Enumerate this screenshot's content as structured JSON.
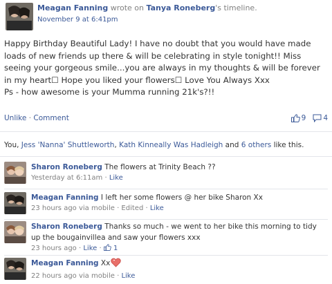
{
  "post": {
    "author": "Meagan Fanning",
    "wrote_on": "wrote on",
    "target": "Tanya Roneberg",
    "target_suffix": "'s timeline.",
    "timestamp": "November 9 at 6:41pm",
    "message": "Happy Birthday Beautiful Lady! I have no doubt that you would have made loads of new friends up there & will be celebrating in style tonight!! Miss seeing your gorgeous smile...you are always in my thoughts & will be forever in my heart☐ Hope you liked your flowers☐ Love You Always Xxx\nPs - how awesome is your Mumma running 21k's?!!"
  },
  "actions": {
    "unlike": "Unlike",
    "separator": "·",
    "comment": "Comment",
    "like_count": "9",
    "comment_count": "4",
    "icons": [
      "thumbs-up-icon",
      "comment-icon"
    ]
  },
  "likes_summary": {
    "prefix": "You, ",
    "name1": "Jess 'Nanna' Shuttleworth",
    "comma": ", ",
    "name2": "Kath Kinneally Was Hadleigh",
    "and": " and ",
    "others": "6 others",
    "suffix": " like this."
  },
  "comments": [
    {
      "author": "Sharon Roneberg",
      "text": "The flowers at Trinity Beach ??",
      "time": "Yesterday at 6:11am",
      "sep": " · ",
      "like": "Like"
    },
    {
      "author": "Meagan Fanning",
      "text": "I left her some flowers @ her bike Sharon Xx",
      "time": "23 hours ago via mobile",
      "edited": " · Edited · ",
      "like": "Like"
    },
    {
      "author": "Sharon Roneberg",
      "text": "Thanks so much - we went to her bike this morning to tidy up the bougainvillea and saw your flowers xxx",
      "time": "23 hours ago",
      "sep": " · ",
      "like": "Like",
      "like_count": "1"
    },
    {
      "author": "Meagan Fanning",
      "text": "Xx",
      "time": "22 hours ago via mobile",
      "sep": " · ",
      "like": "Like"
    }
  ],
  "colors": {
    "link": "#3b5998",
    "meta": "#808080",
    "heart": "#e8706a"
  }
}
